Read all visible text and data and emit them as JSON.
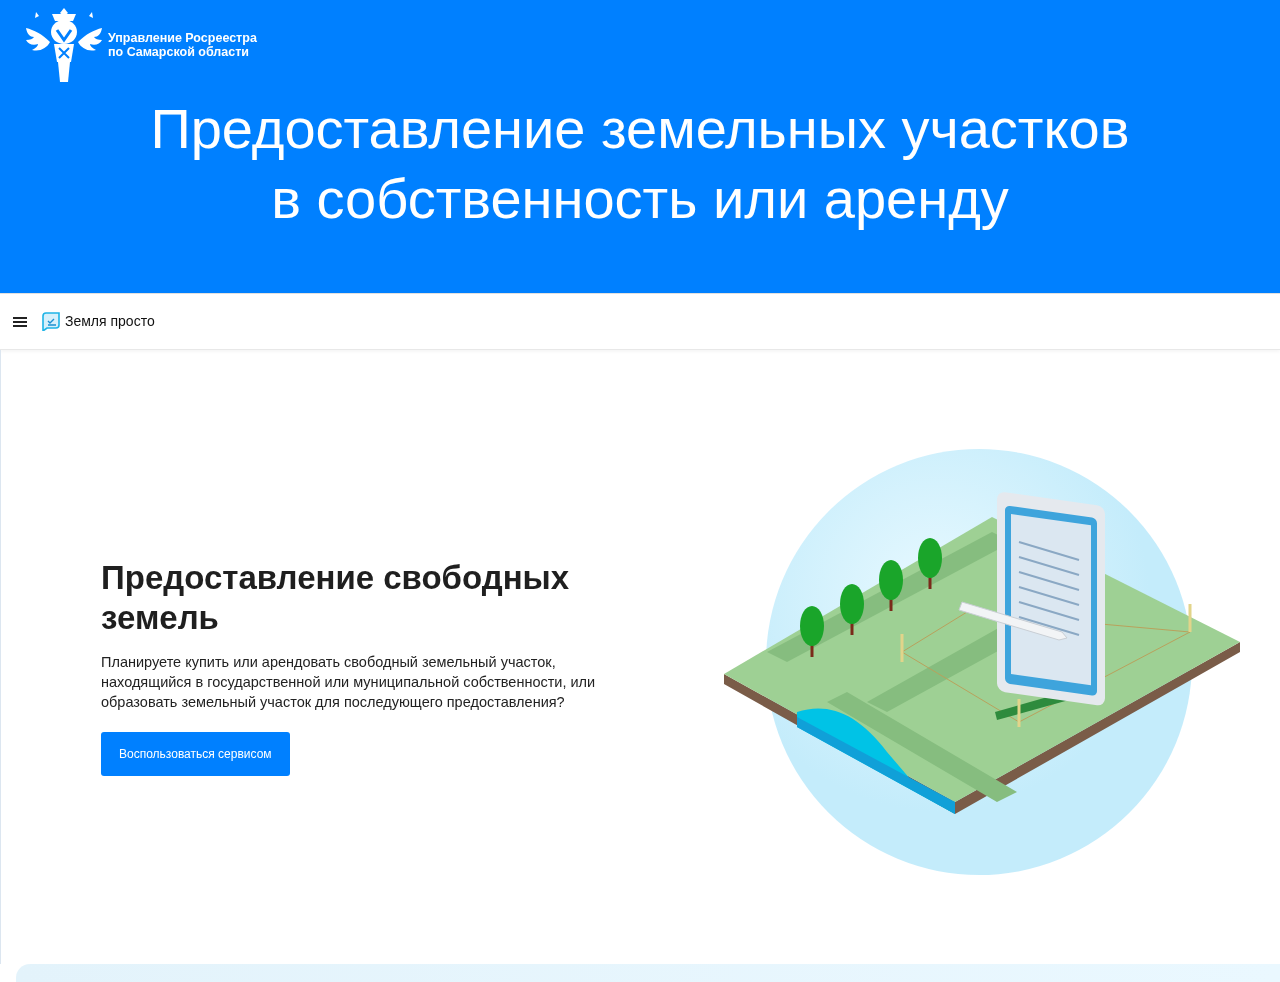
{
  "banner": {
    "org_name": "Управление Росреестра",
    "org_region": "по Самарской области",
    "title_lines": [
      "Предоставление земельных участков",
      "в собственность или аренду"
    ]
  },
  "app_header": {
    "service_name": "Земля просто"
  },
  "hero": {
    "heading": "Предоставление свободных земель",
    "description": "Планируете купить или арендовать свободный земельный участок, находящийся в государственной или муниципальной собственности, или образовать земельный участок для последующего предоставления?",
    "button": "Воспользоваться сервисом"
  }
}
